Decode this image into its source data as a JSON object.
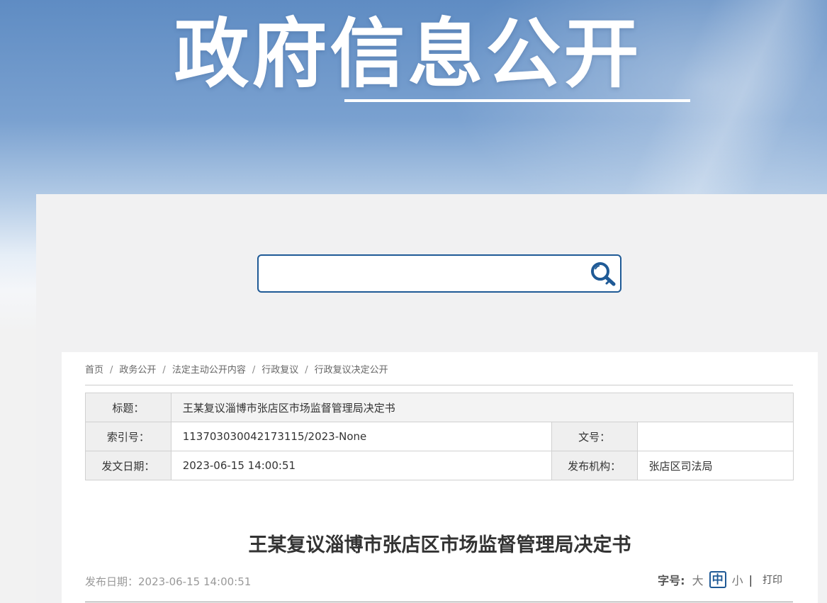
{
  "banner": {
    "title": "政府信息公开"
  },
  "search": {
    "placeholder": "",
    "value": ""
  },
  "breadcrumb": {
    "items": [
      "首页",
      "政务公开",
      "法定主动公开内容",
      "行政复议",
      "行政复议决定公开"
    ],
    "separator": "/"
  },
  "meta": {
    "title_label": "标题：",
    "title_value": "王某复议淄博市张店区市场监督管理局决定书",
    "index_label": "索引号：",
    "index_value": "113703030042173115/2023-None",
    "docno_label": "文号：",
    "docno_value": "",
    "date_label": "发文日期：",
    "date_value": "2023-06-15 14:00:51",
    "org_label": "发布机构：",
    "org_value": "张店区司法局"
  },
  "article": {
    "title": "王某复议淄博市张店区市场监督管理局决定书",
    "pub_date": "发布日期：2023-06-15 14:00:51"
  },
  "tools": {
    "font_size_label": "字号:",
    "large": "大",
    "medium": "中",
    "small": "小",
    "divider": "|",
    "print": "打印"
  },
  "colors": {
    "accent": "#1f5a96",
    "banner_top": "#5f8cc3"
  }
}
